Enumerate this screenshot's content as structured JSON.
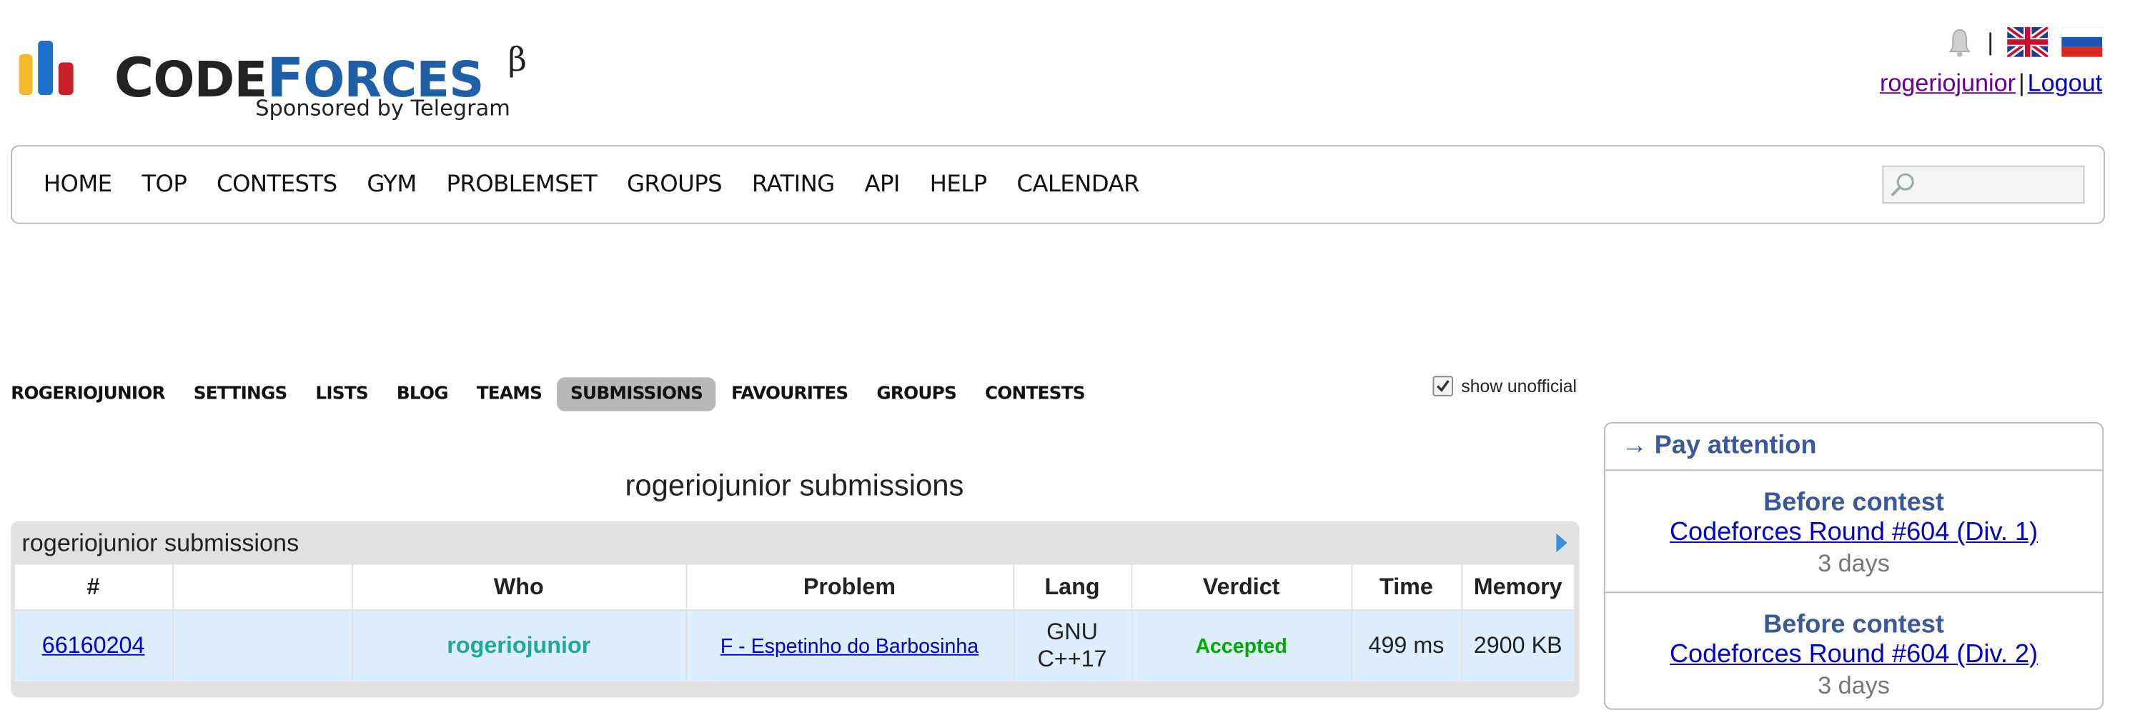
{
  "header": {
    "logo": {
      "text_c": "C",
      "text_ode": "ODE",
      "text_f": "F",
      "text_orces": "ORCES",
      "beta": "β",
      "sponsor": "Sponsored by Telegram",
      "colors": {
        "yellow": "#f5b82e",
        "blue": "#1a73c8",
        "red": "#c8202b"
      }
    },
    "user": {
      "handle": "rogeriojunior",
      "separator": "|",
      "logout": "Logout"
    },
    "lang_separator": "|",
    "icons": [
      "bell-icon",
      "english-flag-icon",
      "russian-flag-icon"
    ]
  },
  "main_menu": {
    "items": [
      "HOME",
      "TOP",
      "CONTESTS",
      "GYM",
      "PROBLEMSET",
      "GROUPS",
      "RATING",
      "API",
      "HELP",
      "CALENDAR"
    ],
    "search": {
      "placeholder": "",
      "icon": "search-icon"
    }
  },
  "second_menu": {
    "items": [
      "ROGERIOJUNIOR",
      "SETTINGS",
      "LISTS",
      "BLOG",
      "TEAMS",
      "SUBMISSIONS",
      "FAVOURITES",
      "GROUPS",
      "CONTESTS"
    ],
    "active": "SUBMISSIONS"
  },
  "show_unofficial": {
    "label": "show unofficial",
    "checked": true
  },
  "submissions": {
    "page_title": "rogeriojunior submissions",
    "box_caption": "rogeriojunior submissions",
    "columns": [
      "#",
      "",
      "Who",
      "Problem",
      "Lang",
      "Verdict",
      "Time",
      "Memory"
    ],
    "rows": [
      {
        "id": "66160204",
        "when": "",
        "who": "rogeriojunior",
        "problem": "F - Espetinho do Barbosinha",
        "lang_line1": "GNU",
        "lang_line2": "C++17",
        "verdict": "Accepted",
        "time": "499 ms",
        "memory": "2900 KB"
      }
    ],
    "colors": {
      "row_bg": "#ddeeff",
      "verdict": "#00aa00",
      "handle": "#20a89b"
    }
  },
  "sidebar": {
    "title": "→ Pay attention",
    "blocks": [
      {
        "heading": "Before contest",
        "link": "Codeforces Round #604 (Div. 1)",
        "when": "3 days"
      },
      {
        "heading": "Before contest",
        "link": "Codeforces Round #604 (Div. 2)",
        "when": "3 days"
      }
    ]
  }
}
